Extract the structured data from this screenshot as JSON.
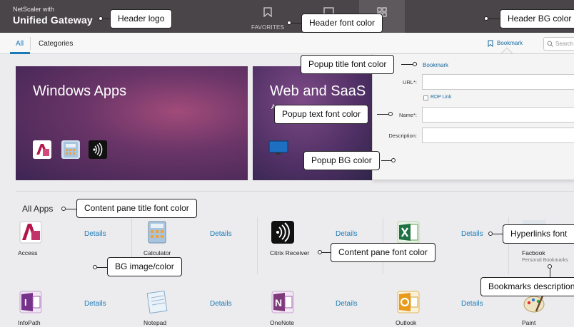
{
  "header": {
    "logo_small": "NetScaler with",
    "logo_big": "Unified Gateway",
    "favorites_label": "FAVORITES"
  },
  "tabs": {
    "all": "All",
    "categories": "Categories",
    "bookmark": "Bookmark",
    "search_placeholder": "Search"
  },
  "banners": {
    "windows_title": "Windows Apps",
    "web_title": "Web and SaaS",
    "web_sub": "A"
  },
  "popup": {
    "title": "Bookmark",
    "url_label": "URL",
    "rdp_label": "RDP Link",
    "name_label": "Name",
    "description_label": "Description"
  },
  "content": {
    "section_title": "All Apps",
    "details_label": "Details",
    "apps_row1": [
      {
        "name": "Access",
        "desc": ""
      },
      {
        "name": "Calculator",
        "desc": ""
      },
      {
        "name": "Citrix Receiver",
        "desc": ""
      },
      {
        "name": "",
        "desc": ""
      },
      {
        "name": "Facbook",
        "desc": "Personal Bookmarks"
      }
    ],
    "apps_row2": [
      {
        "name": "InfoPath"
      },
      {
        "name": "Notepad"
      },
      {
        "name": "OneNote"
      },
      {
        "name": "Outlook"
      },
      {
        "name": "Paint"
      }
    ]
  },
  "callouts": {
    "header_logo": "Header logo",
    "header_font_color": "Header font color",
    "header_bg_color": "Header BG color",
    "popup_title_font_color": "Popup title font color",
    "popup_text_font_color": "Popup text font color",
    "popup_bg_color": "Popup BG color",
    "content_pane_title_font_color": "Content pane title font color",
    "bg_image_color": "BG image/color",
    "content_pane_font_color": "Content pane font color",
    "hyperlinks_font": "Hyperlinks font",
    "bookmarks_description": "Bookmarks description"
  },
  "colors": {
    "header_bg": "#4a4549",
    "accent": "#1a7ab8",
    "popup_bg": "#f4f4f4"
  }
}
